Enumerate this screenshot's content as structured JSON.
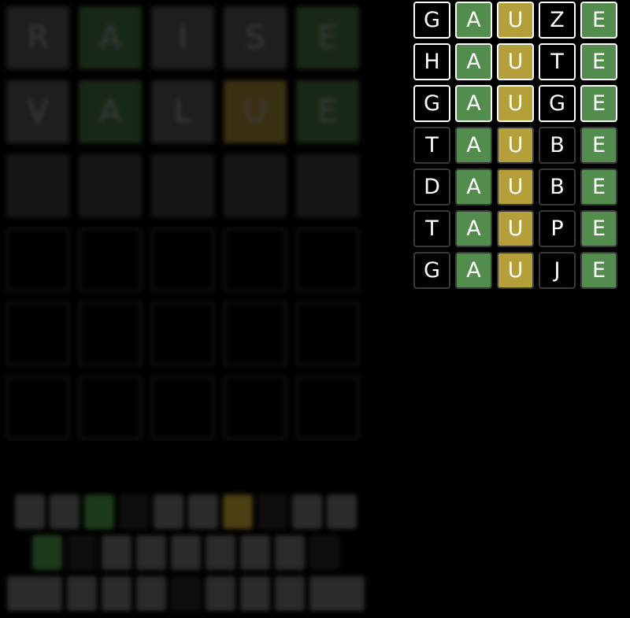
{
  "colors": {
    "green": "#538d4e",
    "yellow": "#b59f3b",
    "absent": "#000000",
    "border_strong": "#ffffff",
    "border_soft": "#3a3a3c",
    "bg_green": "#182818",
    "bg_yellow": "#3a3012",
    "bg_gray": "#1e1e1e",
    "bg_empty": "#161616"
  },
  "background_board": {
    "rows": [
      [
        {
          "letter": "R",
          "state": "gray"
        },
        {
          "letter": "A",
          "state": "green"
        },
        {
          "letter": "I",
          "state": "gray"
        },
        {
          "letter": "S",
          "state": "gray"
        },
        {
          "letter": "E",
          "state": "green"
        }
      ],
      [
        {
          "letter": "V",
          "state": "gray"
        },
        {
          "letter": "A",
          "state": "green"
        },
        {
          "letter": "L",
          "state": "gray"
        },
        {
          "letter": "U",
          "state": "yellow"
        },
        {
          "letter": "E",
          "state": "green"
        }
      ],
      [
        {
          "letter": "",
          "state": "filled"
        },
        {
          "letter": "",
          "state": "filled"
        },
        {
          "letter": "",
          "state": "filled"
        },
        {
          "letter": "",
          "state": "filled"
        },
        {
          "letter": "",
          "state": "filled"
        }
      ],
      [
        {
          "letter": "",
          "state": "empty"
        },
        {
          "letter": "",
          "state": "empty"
        },
        {
          "letter": "",
          "state": "empty"
        },
        {
          "letter": "",
          "state": "empty"
        },
        {
          "letter": "",
          "state": "empty"
        }
      ],
      [
        {
          "letter": "",
          "state": "empty"
        },
        {
          "letter": "",
          "state": "empty"
        },
        {
          "letter": "",
          "state": "empty"
        },
        {
          "letter": "",
          "state": "empty"
        },
        {
          "letter": "",
          "state": "empty"
        }
      ],
      [
        {
          "letter": "",
          "state": "empty"
        },
        {
          "letter": "",
          "state": "empty"
        },
        {
          "letter": "",
          "state": "empty"
        },
        {
          "letter": "",
          "state": "empty"
        },
        {
          "letter": "",
          "state": "empty"
        }
      ]
    ]
  },
  "keyboard": {
    "rows": [
      [
        {
          "state": "gray"
        },
        {
          "state": "gray"
        },
        {
          "state": "green"
        },
        {
          "state": "dark"
        },
        {
          "state": "gray"
        },
        {
          "state": "gray"
        },
        {
          "state": "yellow"
        },
        {
          "state": "dark"
        },
        {
          "state": "gray"
        },
        {
          "state": "gray"
        }
      ],
      [
        {
          "state": "green"
        },
        {
          "state": "dark"
        },
        {
          "state": "gray"
        },
        {
          "state": "gray"
        },
        {
          "state": "gray"
        },
        {
          "state": "gray"
        },
        {
          "state": "gray"
        },
        {
          "state": "gray"
        },
        {
          "state": "dark"
        }
      ],
      [
        {
          "state": "wide"
        },
        {
          "state": "gray"
        },
        {
          "state": "gray"
        },
        {
          "state": "gray"
        },
        {
          "state": "dark"
        },
        {
          "state": "gray"
        },
        {
          "state": "gray"
        },
        {
          "state": "gray"
        },
        {
          "state": "wide"
        }
      ]
    ]
  },
  "candidates": {
    "rows": [
      [
        {
          "letter": "G",
          "state": "absent",
          "border": "strong"
        },
        {
          "letter": "A",
          "state": "green",
          "border": "strong"
        },
        {
          "letter": "U",
          "state": "yellow",
          "border": "strong"
        },
        {
          "letter": "Z",
          "state": "absent",
          "border": "strong"
        },
        {
          "letter": "E",
          "state": "green",
          "border": "strong"
        }
      ],
      [
        {
          "letter": "H",
          "state": "absent",
          "border": "strong"
        },
        {
          "letter": "A",
          "state": "green",
          "border": "strong"
        },
        {
          "letter": "U",
          "state": "yellow",
          "border": "strong"
        },
        {
          "letter": "T",
          "state": "absent",
          "border": "strong"
        },
        {
          "letter": "E",
          "state": "green",
          "border": "strong"
        }
      ],
      [
        {
          "letter": "G",
          "state": "absent",
          "border": "strong"
        },
        {
          "letter": "A",
          "state": "green",
          "border": "strong"
        },
        {
          "letter": "U",
          "state": "yellow",
          "border": "strong"
        },
        {
          "letter": "G",
          "state": "absent",
          "border": "strong"
        },
        {
          "letter": "E",
          "state": "green",
          "border": "strong"
        }
      ],
      [
        {
          "letter": "T",
          "state": "absent",
          "border": "soft"
        },
        {
          "letter": "A",
          "state": "green",
          "border": "soft"
        },
        {
          "letter": "U",
          "state": "yellow",
          "border": "soft"
        },
        {
          "letter": "B",
          "state": "absent",
          "border": "soft"
        },
        {
          "letter": "E",
          "state": "green",
          "border": "soft"
        }
      ],
      [
        {
          "letter": "D",
          "state": "absent",
          "border": "soft"
        },
        {
          "letter": "A",
          "state": "green",
          "border": "soft"
        },
        {
          "letter": "U",
          "state": "yellow",
          "border": "soft"
        },
        {
          "letter": "B",
          "state": "absent",
          "border": "soft"
        },
        {
          "letter": "E",
          "state": "green",
          "border": "soft"
        }
      ],
      [
        {
          "letter": "T",
          "state": "absent",
          "border": "soft"
        },
        {
          "letter": "A",
          "state": "green",
          "border": "soft"
        },
        {
          "letter": "U",
          "state": "yellow",
          "border": "soft"
        },
        {
          "letter": "P",
          "state": "absent",
          "border": "soft"
        },
        {
          "letter": "E",
          "state": "green",
          "border": "soft"
        }
      ],
      [
        {
          "letter": "G",
          "state": "absent",
          "border": "soft"
        },
        {
          "letter": "A",
          "state": "green",
          "border": "soft"
        },
        {
          "letter": "U",
          "state": "yellow",
          "border": "soft"
        },
        {
          "letter": "J",
          "state": "absent",
          "border": "soft"
        },
        {
          "letter": "E",
          "state": "green",
          "border": "soft"
        }
      ]
    ]
  }
}
